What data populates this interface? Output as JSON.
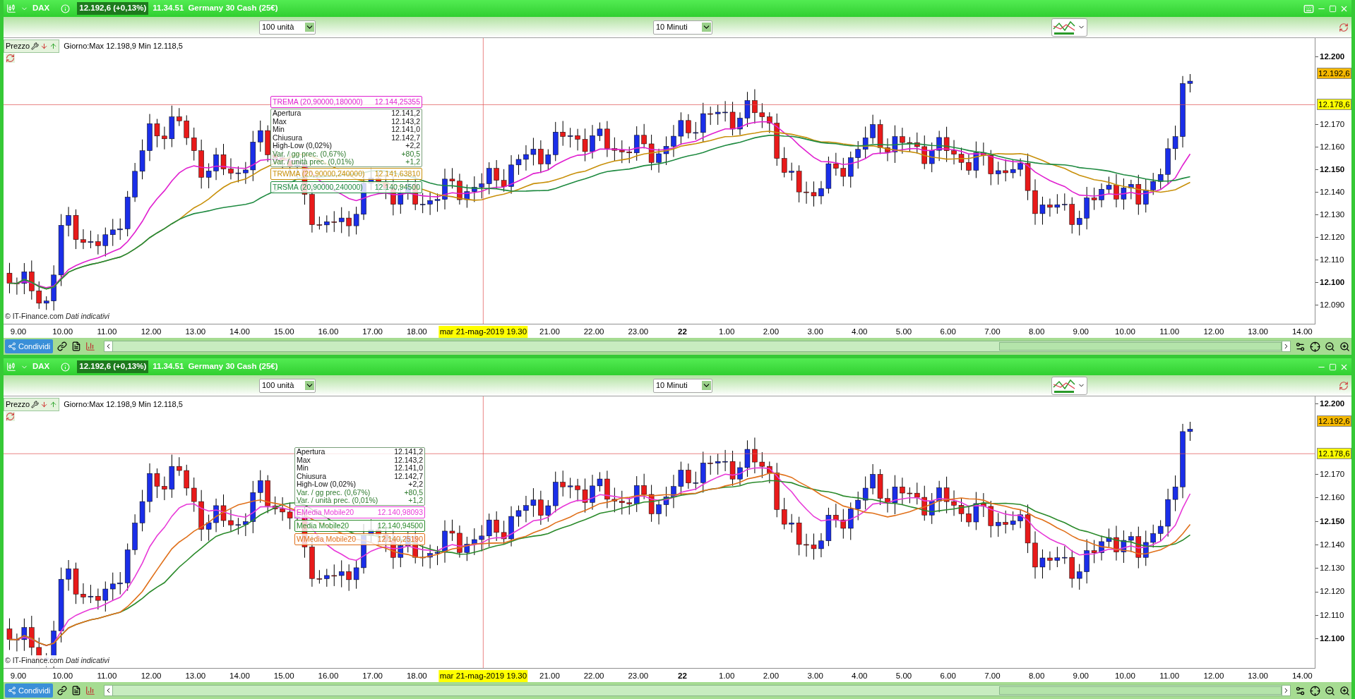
{
  "panels": [
    {
      "header": {
        "symbol": "DAX",
        "price": "12.192,6 (+0,13%)",
        "time": "11.34.51",
        "name": "Germany 30 Cash (25€)",
        "keyboard": true
      },
      "units": "100 unità",
      "interval": "10 Minuti",
      "price_label": "Prezzo",
      "day_range": "Giorno:Max 12.198,9 Min 12.118,5",
      "y_ticks": [
        {
          "label": "12.200",
          "major": true
        },
        {
          "label": "12.170",
          "major": false
        },
        {
          "label": "12.160",
          "major": false
        },
        {
          "label": "12.150",
          "major": true
        },
        {
          "label": "12.140",
          "major": false
        },
        {
          "label": "12.130",
          "major": false
        },
        {
          "label": "12.120",
          "major": false
        },
        {
          "label": "12.110",
          "major": false
        },
        {
          "label": "12.100",
          "major": true
        },
        {
          "label": "12.090",
          "major": false
        }
      ],
      "price_tags": [
        {
          "label": "12.192,6",
          "color": "#f5b800"
        },
        {
          "label": "12.178,6",
          "color": "#ffff00"
        }
      ],
      "x_ticks": [
        {
          "label": "9.00",
          "kind": "tick"
        },
        {
          "label": "10.00",
          "kind": "tick"
        },
        {
          "label": "11.00",
          "kind": "tick"
        },
        {
          "label": "12.00",
          "kind": "tick"
        },
        {
          "label": "13.00",
          "kind": "tick"
        },
        {
          "label": "14.00",
          "kind": "tick"
        },
        {
          "label": "15.00",
          "kind": "tick"
        },
        {
          "label": "16.00",
          "kind": "tick"
        },
        {
          "label": "17.00",
          "kind": "tick"
        },
        {
          "label": "18.00",
          "kind": "tick"
        },
        {
          "label": "mar 21-mag-2019 19.30",
          "kind": "cursor"
        },
        {
          "label": "21.00",
          "kind": "tick"
        },
        {
          "label": "22.00",
          "kind": "tick"
        },
        {
          "label": "23.00",
          "kind": "tick"
        },
        {
          "label": "22",
          "kind": "day"
        },
        {
          "label": "1.00",
          "kind": "tick"
        },
        {
          "label": "2.00",
          "kind": "tick"
        },
        {
          "label": "3.00",
          "kind": "tick"
        },
        {
          "label": "4.00",
          "kind": "tick"
        },
        {
          "label": "5.00",
          "kind": "tick"
        },
        {
          "label": "6.00",
          "kind": "tick"
        },
        {
          "label": "7.00",
          "kind": "tick"
        },
        {
          "label": "8.00",
          "kind": "tick"
        },
        {
          "label": "9.00",
          "kind": "tick"
        },
        {
          "label": "10.00",
          "kind": "tick"
        },
        {
          "label": "11.00",
          "kind": "tick"
        },
        {
          "label": "12.00",
          "kind": "tick"
        },
        {
          "label": "13.00",
          "kind": "tick"
        },
        {
          "label": "14.00",
          "kind": "tick"
        }
      ],
      "credit": "© IT-Finance.com",
      "credit_note": "Dati indicativi",
      "tooltip": [
        {
          "label": "Apertura",
          "value": "12.141,2",
          "kind": "plain"
        },
        {
          "label": "Max",
          "value": "12.143,2",
          "kind": "plain"
        },
        {
          "label": "Min",
          "value": "12.141,0",
          "kind": "plain"
        },
        {
          "label": "Chiusura",
          "value": "12.142,7",
          "kind": "plain"
        },
        {
          "label": "High-Low (0,02%)",
          "value": "+2,2",
          "kind": "plain"
        },
        {
          "label": "Var. / gg prec. (0,67%)",
          "value": "+80,5",
          "kind": "change"
        },
        {
          "label": "Var. / unità prec. (0,01%)",
          "value": "+1,2",
          "kind": "change"
        }
      ],
      "indicators_above": [
        {
          "label": "TREMA (20,90000,180000)",
          "value": "12.144,25355",
          "color": "#e020d0"
        }
      ],
      "indicators": [
        {
          "label": "TRWMA (20,90000,240000)",
          "value": "12.141,63810",
          "color": "#c8900a"
        },
        {
          "label": "TRSMA (20,90000,240000)",
          "value": "12.140,94500",
          "color": "#1e8a40"
        }
      ],
      "share": "Condividi"
    },
    {
      "header": {
        "symbol": "DAX",
        "price": "12.192,6 (+0,13%)",
        "time": "11.34.51",
        "name": "Germany 30 Cash (25€)",
        "keyboard": false
      },
      "units": "100 unità",
      "interval": "10 Minuti",
      "price_label": "Prezzo",
      "day_range": "Giorno:Max 12.198,9 Min 12.118,5",
      "y_ticks": [
        {
          "label": "12.200",
          "major": true
        },
        {
          "label": "12.170",
          "major": false
        },
        {
          "label": "12.160",
          "major": false
        },
        {
          "label": "12.150",
          "major": true
        },
        {
          "label": "12.140",
          "major": false
        },
        {
          "label": "12.130",
          "major": false
        },
        {
          "label": "12.120",
          "major": false
        },
        {
          "label": "12.110",
          "major": false
        },
        {
          "label": "12.100",
          "major": true
        }
      ],
      "price_tags": [
        {
          "label": "12.192,6",
          "color": "#f5b800"
        },
        {
          "label": "12.178,6",
          "color": "#ffff00"
        }
      ],
      "x_ticks": [
        {
          "label": "9.00",
          "kind": "tick"
        },
        {
          "label": "10.00",
          "kind": "tick"
        },
        {
          "label": "11.00",
          "kind": "tick"
        },
        {
          "label": "12.00",
          "kind": "tick"
        },
        {
          "label": "13.00",
          "kind": "tick"
        },
        {
          "label": "14.00",
          "kind": "tick"
        },
        {
          "label": "15.00",
          "kind": "tick"
        },
        {
          "label": "16.00",
          "kind": "tick"
        },
        {
          "label": "17.00",
          "kind": "tick"
        },
        {
          "label": "18.00",
          "kind": "tick"
        },
        {
          "label": "mar 21-mag-2019 19.30",
          "kind": "cursor"
        },
        {
          "label": "21.00",
          "kind": "tick"
        },
        {
          "label": "22.00",
          "kind": "tick"
        },
        {
          "label": "23.00",
          "kind": "tick"
        },
        {
          "label": "22",
          "kind": "day"
        },
        {
          "label": "1.00",
          "kind": "tick"
        },
        {
          "label": "2.00",
          "kind": "tick"
        },
        {
          "label": "3.00",
          "kind": "tick"
        },
        {
          "label": "4.00",
          "kind": "tick"
        },
        {
          "label": "5.00",
          "kind": "tick"
        },
        {
          "label": "6.00",
          "kind": "tick"
        },
        {
          "label": "7.00",
          "kind": "tick"
        },
        {
          "label": "8.00",
          "kind": "tick"
        },
        {
          "label": "9.00",
          "kind": "tick"
        },
        {
          "label": "10.00",
          "kind": "tick"
        },
        {
          "label": "11.00",
          "kind": "tick"
        },
        {
          "label": "12.00",
          "kind": "tick"
        },
        {
          "label": "13.00",
          "kind": "tick"
        },
        {
          "label": "14.00",
          "kind": "tick"
        }
      ],
      "credit": "© IT-Finance.com",
      "credit_note": "Dati indicativi",
      "tooltip": [
        {
          "label": "Apertura",
          "value": "12.141,2",
          "kind": "plain"
        },
        {
          "label": "Max",
          "value": "12.143,2",
          "kind": "plain"
        },
        {
          "label": "Min",
          "value": "12.141,0",
          "kind": "plain"
        },
        {
          "label": "Chiusura",
          "value": "12.142,7",
          "kind": "plain"
        },
        {
          "label": "High-Low (0,02%)",
          "value": "+2,2",
          "kind": "plain"
        },
        {
          "label": "Var. / gg prec. (0,67%)",
          "value": "+80,5",
          "kind": "change"
        },
        {
          "label": "Var. / unità prec. (0,01%)",
          "value": "+1,2",
          "kind": "change"
        }
      ],
      "indicators": [
        {
          "label": "EMedia Mobile20",
          "value": "12.140,98093",
          "color": "#e83ad8"
        },
        {
          "label": "Media Mobile20",
          "value": "12.140,94500",
          "color": "#2a8a2a"
        },
        {
          "label": "WMedia Mobile20",
          "value": "12.140,25190",
          "color": "#e0701a"
        }
      ],
      "share": "Condividi"
    }
  ]
}
